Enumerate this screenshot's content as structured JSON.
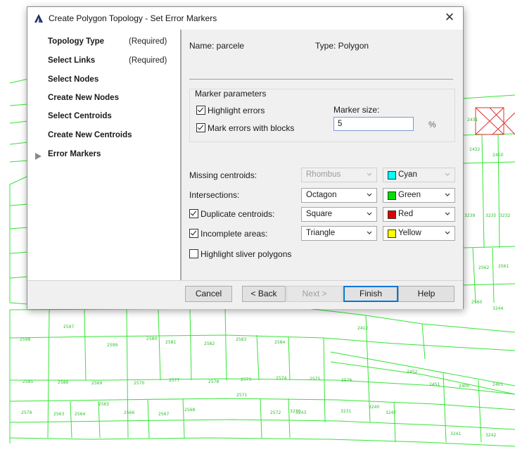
{
  "window": {
    "title": "Create Polygon Topology - Set Error Markers"
  },
  "nav": [
    {
      "label": "Topology Type",
      "note": "(Required)"
    },
    {
      "label": "Select Links",
      "note": "(Required)"
    },
    {
      "label": "Select Nodes",
      "note": ""
    },
    {
      "label": "Create New Nodes",
      "note": ""
    },
    {
      "label": "Select Centroids",
      "note": ""
    },
    {
      "label": "Create New Centroids",
      "note": ""
    },
    {
      "label": "Error Markers",
      "note": "",
      "current": true
    }
  ],
  "info": {
    "name": "Name: parcele",
    "type": "Type: Polygon"
  },
  "marker_params": {
    "group_label": "Marker parameters",
    "highlight_errors": {
      "label": "Highlight errors",
      "checked": true
    },
    "mark_with_blocks": {
      "label": "Mark errors with blocks",
      "checked": true
    },
    "size_label": "Marker size:",
    "size_value": "5",
    "size_unit": "%"
  },
  "errors": [
    {
      "label": "Missing centroids:",
      "shape": "Rhombus",
      "color": "Cyan",
      "swatch": "#00ffff",
      "checkbox": false,
      "disabled": true
    },
    {
      "label": "Intersections:",
      "shape": "Octagon",
      "color": "Green",
      "swatch": "#00e000",
      "checkbox": false,
      "disabled": false
    },
    {
      "label": "Duplicate centroids:",
      "shape": "Square",
      "color": "Red",
      "swatch": "#e00000",
      "checkbox": true,
      "checked": true,
      "disabled": false
    },
    {
      "label": "Incomplete areas:",
      "shape": "Triangle",
      "color": "Yellow",
      "swatch": "#ffff00",
      "checkbox": true,
      "checked": true,
      "disabled": false
    }
  ],
  "sliver": {
    "label": "Highlight sliver polygons",
    "checked": false
  },
  "buttons": {
    "cancel": "Cancel",
    "back": "< Back",
    "next": "Next >",
    "finish": "Finish",
    "help": "Help"
  },
  "map_labels": [
    "2597",
    "2598",
    "2599",
    "2580",
    "2581",
    "2582",
    "2583",
    "2584",
    "2585",
    "2586",
    "2569",
    "2570",
    "2577",
    "2578",
    "2573",
    "2574",
    "2575",
    "2576",
    "2579",
    "2563",
    "2564",
    "2565",
    "2566",
    "2567",
    "2568",
    "2571",
    "2572",
    "3230",
    "3231",
    "3240",
    "3247",
    "2412",
    "2452",
    "2451",
    "2400",
    "2401",
    "2431",
    "2432",
    "2450",
    "3239",
    "3235",
    "3232",
    "2562",
    "2561",
    "2560",
    "3244",
    "3243",
    "3241",
    "3242"
  ]
}
